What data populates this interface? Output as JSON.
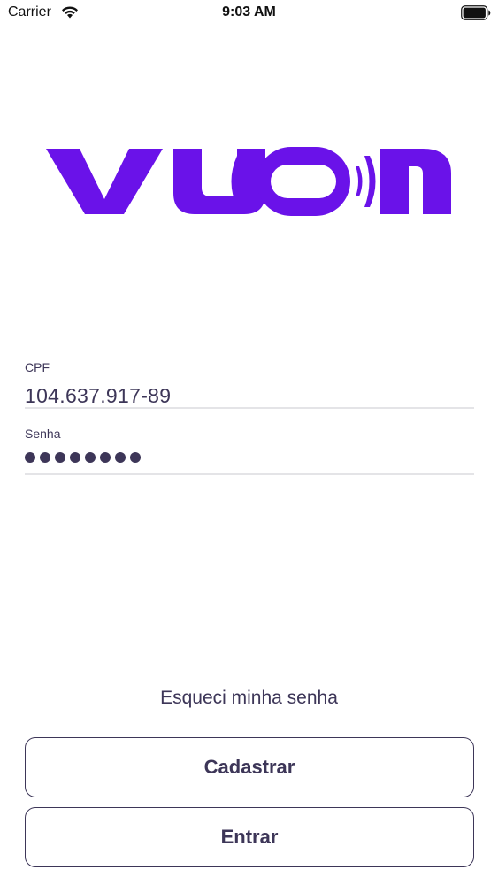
{
  "status_bar": {
    "carrier": "Carrier",
    "time": "9:03 AM",
    "wifi_icon": "wifi-icon",
    "battery_icon": "battery-full-icon"
  },
  "brand": {
    "logo_text": "vuon",
    "color": "#6a12e9"
  },
  "form": {
    "cpf": {
      "label": "CPF",
      "value": "104.637.917-89"
    },
    "password": {
      "label": "Senha",
      "masked_length": 8
    }
  },
  "links": {
    "forgot_password": "Esqueci minha senha"
  },
  "buttons": {
    "register": "Cadastrar",
    "login": "Entrar"
  },
  "colors": {
    "text": "#3d3658",
    "divider": "#e4e4e7",
    "background": "#ffffff"
  }
}
